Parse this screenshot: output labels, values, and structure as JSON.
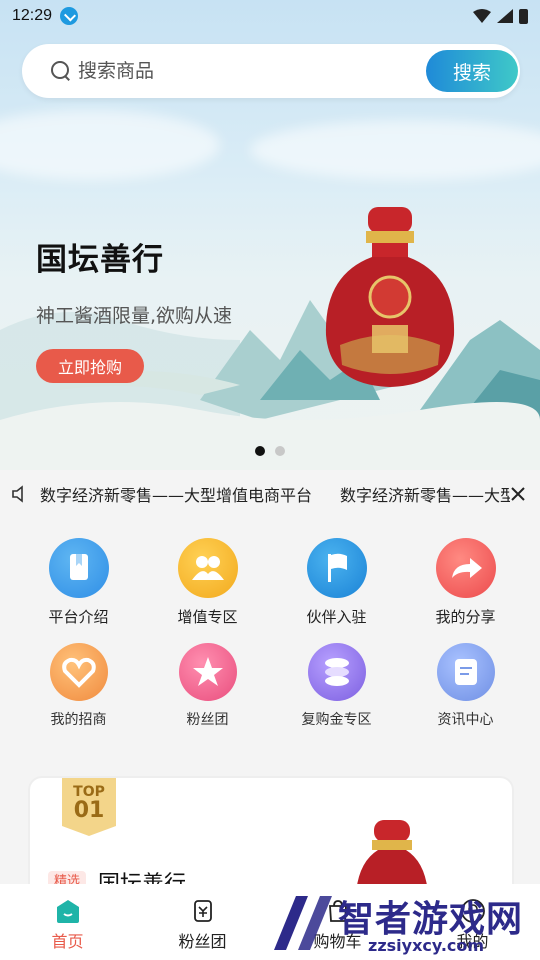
{
  "status_bar": {
    "time": "12:29"
  },
  "search": {
    "placeholder": "搜索商品",
    "button_label": "搜索"
  },
  "banner": {
    "title": "国坛善行",
    "subtitle": "神工酱酒限量,欲购从速",
    "button_label": "立即抢购",
    "dots": 2,
    "active_dot": 0
  },
  "notice": {
    "messages": [
      "数字经济新零售——大型增值电商平台",
      "数字经济新零售——大型增值电商平台"
    ]
  },
  "menu_row1": [
    {
      "label": "平台介绍",
      "icon": "book-icon",
      "color": "#2f93e6"
    },
    {
      "label": "增值专区",
      "icon": "group-icon",
      "color": "#f5b325"
    },
    {
      "label": "伙伴入驻",
      "icon": "flag-icon",
      "color": "#1f8fd9"
    },
    {
      "label": "我的分享",
      "icon": "share-icon",
      "color": "#ef5a56"
    }
  ],
  "menu_row2": [
    {
      "label": "我的招商",
      "icon": "heart-icon",
      "color": "#f39a4b"
    },
    {
      "label": "粉丝团",
      "icon": "star-icon",
      "color": "#ef5c86"
    },
    {
      "label": "复购金专区",
      "icon": "coins-icon",
      "color": "#8b6de8"
    },
    {
      "label": "资讯中心",
      "icon": "document-icon",
      "color": "#7b9be8"
    }
  ],
  "product_card": {
    "badge_top": "TOP",
    "badge_rank": "01",
    "tag": "精选",
    "title": "国坛善行"
  },
  "bottom_nav": [
    {
      "label": "首页",
      "icon": "home-icon",
      "active": true
    },
    {
      "label": "粉丝团",
      "icon": "fans-icon",
      "active": false
    },
    {
      "label": "购物车",
      "icon": "cart-icon",
      "active": false
    },
    {
      "label": "我的",
      "icon": "user-icon",
      "active": false
    }
  ],
  "watermark": {
    "text": "智者游戏网",
    "url": "zzsiyxcy.com"
  },
  "colors": {
    "accent": "#e85a4a",
    "search_gradient_start": "#1f8ad8",
    "search_gradient_end": "#3fc9c8"
  }
}
